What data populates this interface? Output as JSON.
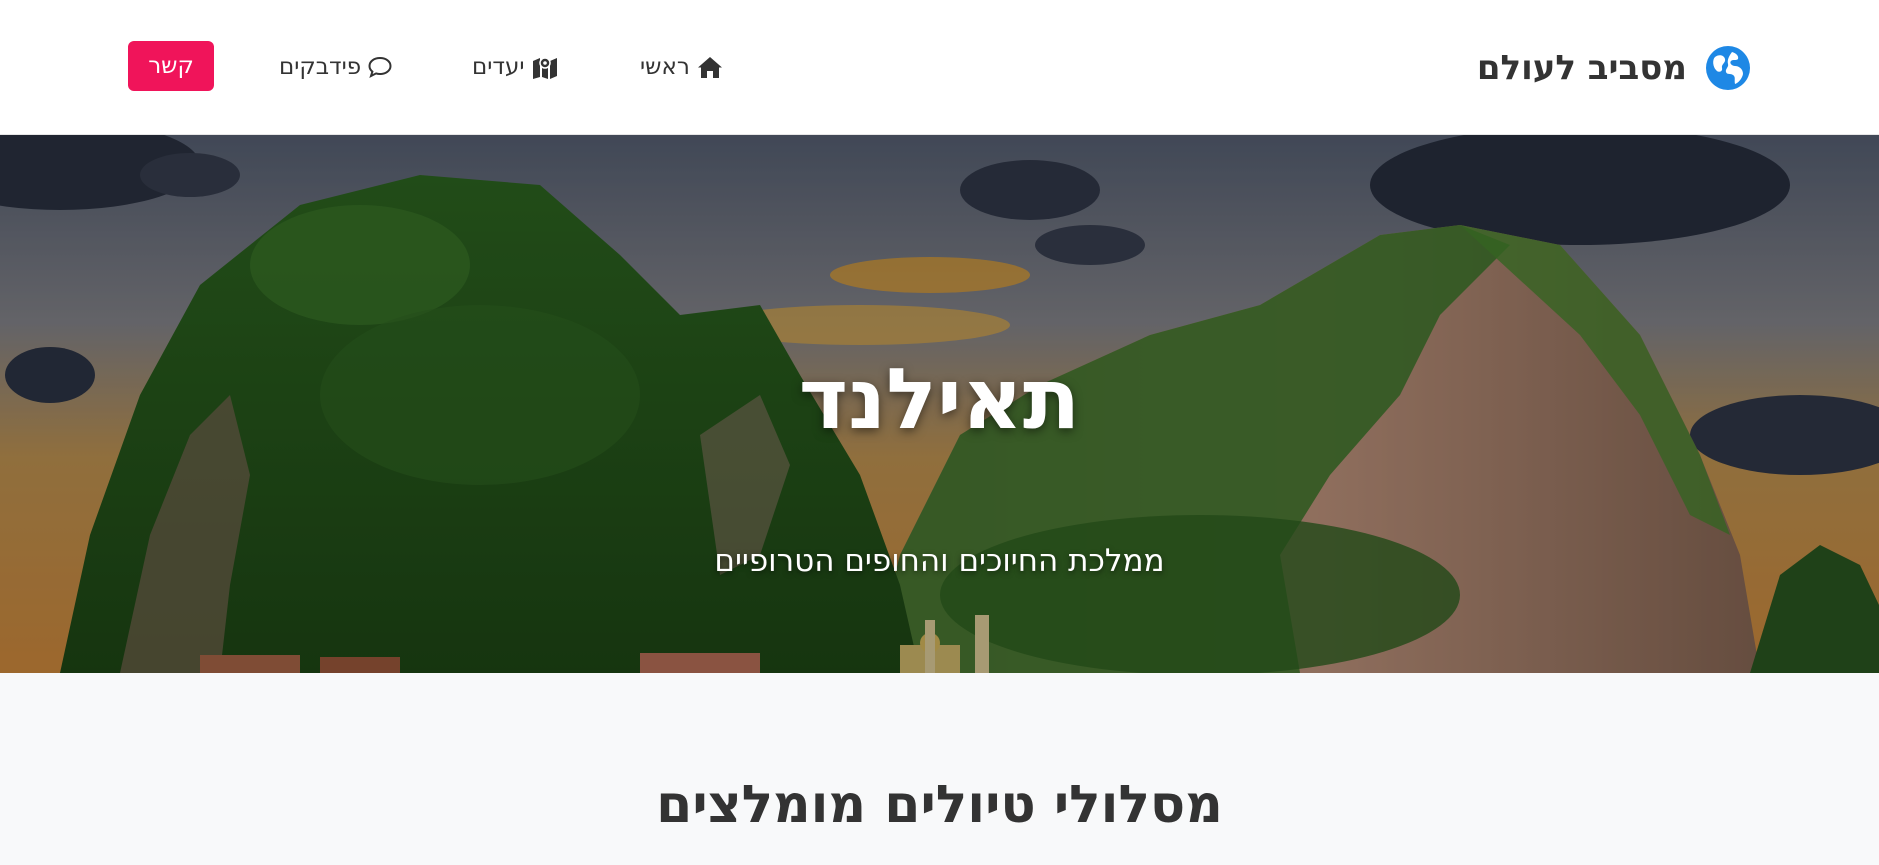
{
  "navbar": {
    "brand": {
      "text": "מסביב לעולם",
      "icon": "globe-icon",
      "icon_color": "#1e88e5"
    },
    "links": {
      "home": {
        "label": "ראשי",
        "icon": "home-icon"
      },
      "destinations": {
        "label": "יעדים",
        "icon": "map-icon"
      },
      "feedback": {
        "label": "פידבקים",
        "icon": "comment-icon"
      }
    },
    "contact_button": {
      "label": "קשר",
      "color": "#f0145a"
    }
  },
  "hero": {
    "title": "תאילנד",
    "subtitle": "ממלכת החיוכים והחופים הטרופיים"
  },
  "section": {
    "title": "מסלולי טיולים מומלצים"
  }
}
